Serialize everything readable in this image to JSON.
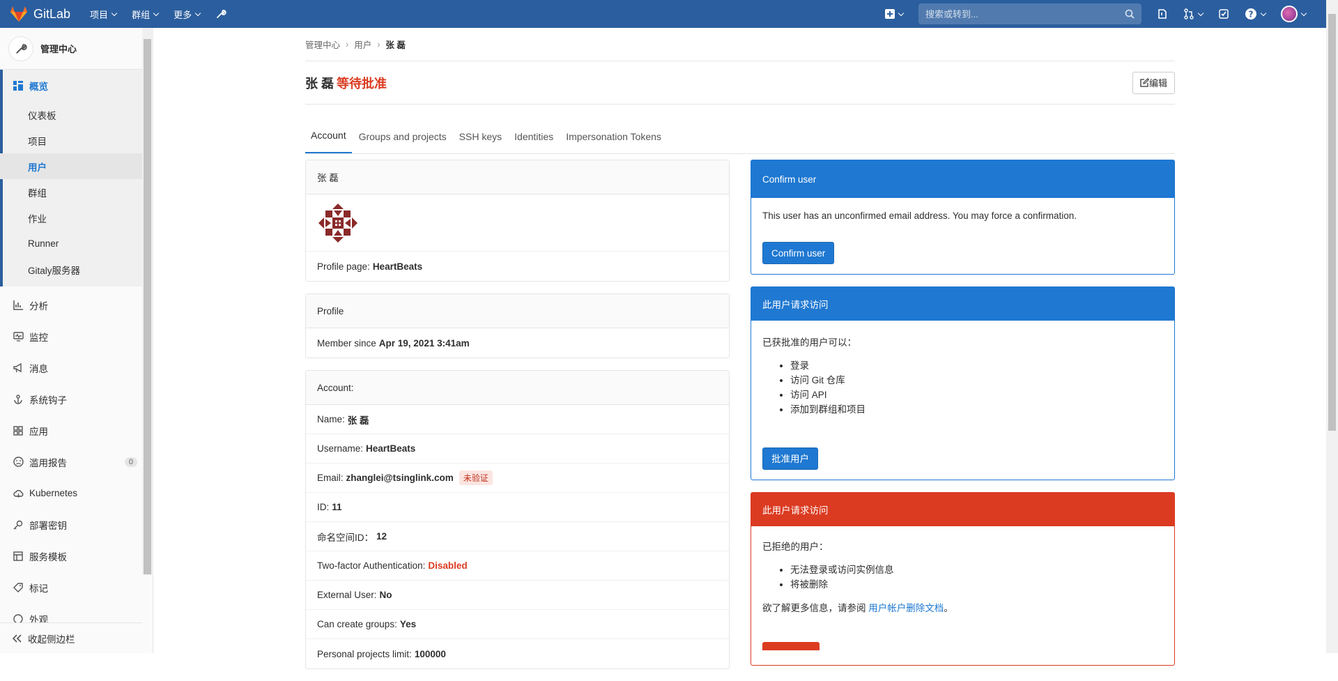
{
  "topbar": {
    "brand": "GitLab",
    "nav": [
      "项目",
      "群组",
      "更多"
    ],
    "search_placeholder": "搜索或转到..."
  },
  "sidebar": {
    "title": "管理中心",
    "overview": "概览",
    "overview_items": [
      "仪表板",
      "项目",
      "用户",
      "群组",
      "作业",
      "Runner",
      "Gitaly服务器"
    ],
    "items": [
      {
        "label": "分析",
        "icon": "chart-icon"
      },
      {
        "label": "监控",
        "icon": "monitor-icon"
      },
      {
        "label": "消息",
        "icon": "megaphone-icon"
      },
      {
        "label": "系统钩子",
        "icon": "hook-icon"
      },
      {
        "label": "应用",
        "icon": "apps-icon"
      },
      {
        "label": "滥用报告",
        "icon": "abuse-icon",
        "count": "0"
      },
      {
        "label": "Kubernetes",
        "icon": "cloud-icon"
      },
      {
        "label": "部署密钥",
        "icon": "key-icon"
      },
      {
        "label": "服务模板",
        "icon": "template-icon"
      },
      {
        "label": "标记",
        "icon": "label-icon"
      },
      {
        "label": "外观",
        "icon": "appearance-icon"
      }
    ],
    "collapse": "收起侧边栏"
  },
  "breadcrumb": [
    "管理中心",
    "用户",
    "张 磊"
  ],
  "header": {
    "name": "张 磊",
    "status": "等待批准",
    "edit": "编辑"
  },
  "tabs": [
    "Account",
    "Groups and projects",
    "SSH keys",
    "Identities",
    "Impersonation Tokens"
  ],
  "user_card": {
    "name": "张 磊",
    "profile_label": "Profile page:",
    "profile_value": "HeartBeats"
  },
  "profile_card": {
    "title": "Profile",
    "member_label": "Member since",
    "member_value": "Apr 19, 2021 3:41am"
  },
  "account_card": {
    "title": "Account:",
    "rows": [
      {
        "label": "Name:",
        "value": "张 磊"
      },
      {
        "label": "Username:",
        "value": "HeartBeats"
      },
      {
        "label": "Email:",
        "value": "zhanglei@tsinglink.com",
        "badge": "未验证"
      },
      {
        "label": "ID:",
        "value": "11"
      },
      {
        "label": "命名空间ID：",
        "value": "12"
      },
      {
        "label": "Two-factor Authentication:",
        "value": "Disabled"
      },
      {
        "label": "External User:",
        "value": "No"
      },
      {
        "label": "Can create groups:",
        "value": "Yes"
      },
      {
        "label": "Personal projects limit:",
        "value": "100000"
      }
    ]
  },
  "confirm_card": {
    "title": "Confirm user",
    "text": "This user has an unconfirmed email address. You may force a confirmation.",
    "button": "Confirm user"
  },
  "approve_card": {
    "title": "此用户请求访问",
    "intro": "已获批准的用户可以：",
    "items": [
      "登录",
      "访问 Git 仓库",
      "访问 API",
      "添加到群组和项目"
    ],
    "button": "批准用户"
  },
  "reject_card": {
    "title": "此用户请求访问",
    "intro": "已拒绝的用户：",
    "items": [
      "无法登录或访问实例信息",
      "将被删除"
    ],
    "more_prefix": "欲了解更多信息，请参阅",
    "more_link": "用户帐户删除文档",
    "more_suffix": "。"
  }
}
